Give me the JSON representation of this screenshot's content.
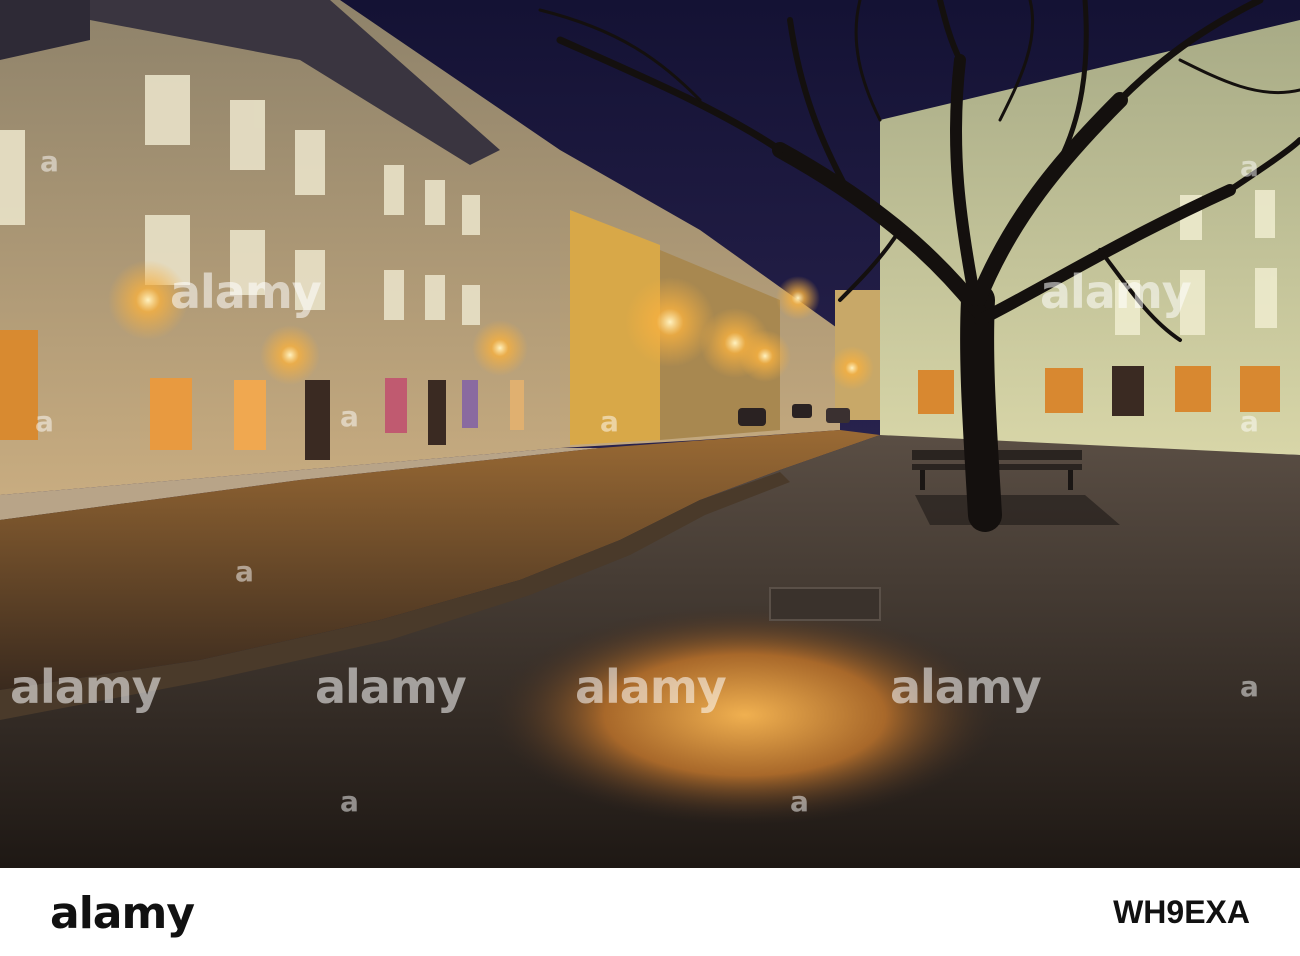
{
  "photo": {
    "description_colors": {
      "sky": "#1c1840",
      "lamp_glow": "#f4a630",
      "cobblestone": "#6b4a2a",
      "building_left": "#c9b48c",
      "building_right": "#c8c9a0",
      "pavement": "#3a2e28"
    }
  },
  "watermarks": {
    "w1": "alamy",
    "w2": "alamy",
    "w3": "alamy",
    "w4": "alamy",
    "w5": "alamy",
    "w6": "alamy",
    "w7": "a",
    "w8": "a",
    "w9": "a",
    "w10": "a",
    "w11": "a",
    "w12": "a",
    "w13": "a",
    "w14": "a",
    "w15": "a",
    "w16": "a"
  },
  "footer": {
    "brand": "alamy",
    "image_id": "WH9EXA"
  }
}
